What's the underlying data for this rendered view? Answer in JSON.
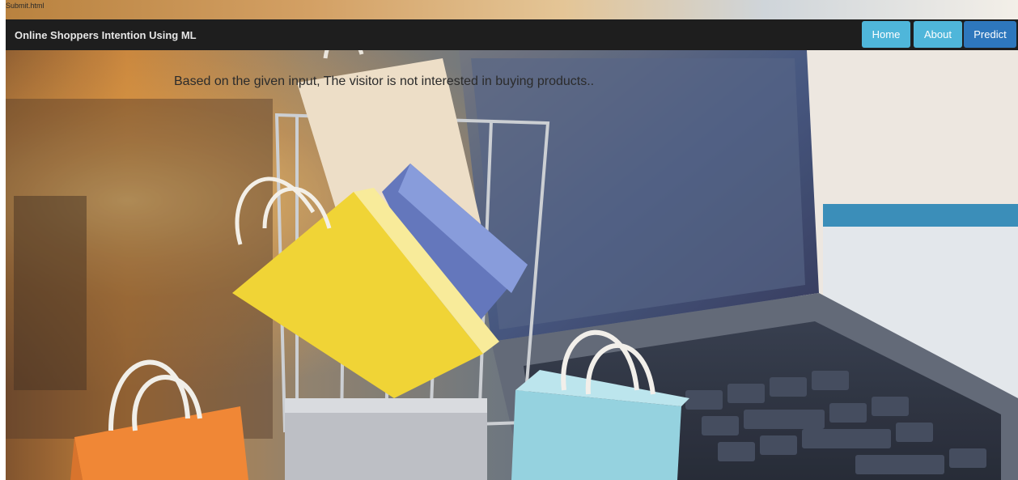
{
  "browser": {
    "tab_title": "Submit.html"
  },
  "navbar": {
    "brand": "Online Shoppers Intention Using ML",
    "links": [
      {
        "label": "Home"
      },
      {
        "label": "About"
      },
      {
        "label": "Predict"
      }
    ]
  },
  "main": {
    "result_text": "Based on the given input, The visitor is not interested in buying products.."
  },
  "colors": {
    "navbar_bg": "#1e1e1e",
    "nav_button": "#4fb6da",
    "nav_button_active": "#2e77bd"
  }
}
